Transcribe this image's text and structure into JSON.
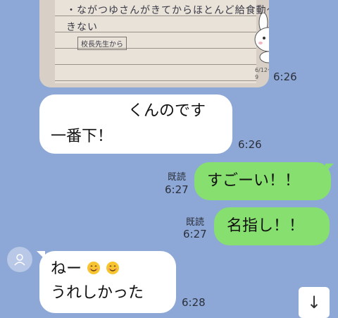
{
  "photo": {
    "line1": "・ながつゆさんがきてからほとんど給食動〜",
    "line2": "きない",
    "stamp": "校長先生から",
    "date": "6/12〜9"
  },
  "messages": [
    {
      "side": "left",
      "lines": [
        "くんのです",
        "一番下！"
      ],
      "time": "6:26"
    },
    {
      "side": "right",
      "text": "すごーい！！",
      "read": "既読",
      "time": "6:27"
    },
    {
      "side": "right",
      "text": "名指し！！",
      "read": "既読",
      "time": "6:27"
    },
    {
      "side": "left",
      "lines": [
        "ねー",
        "うれしかった"
      ],
      "emoji": [
        "smiling-face",
        "smiling-face"
      ],
      "time": "6:28"
    }
  ],
  "photo_time": "6:26",
  "scroll_button": {
    "icon": "arrow-down-icon",
    "glyph": "↓"
  },
  "colors": {
    "background": "#8da8d6",
    "bubble_self": "#86df6e",
    "bubble_other": "#ffffff"
  }
}
